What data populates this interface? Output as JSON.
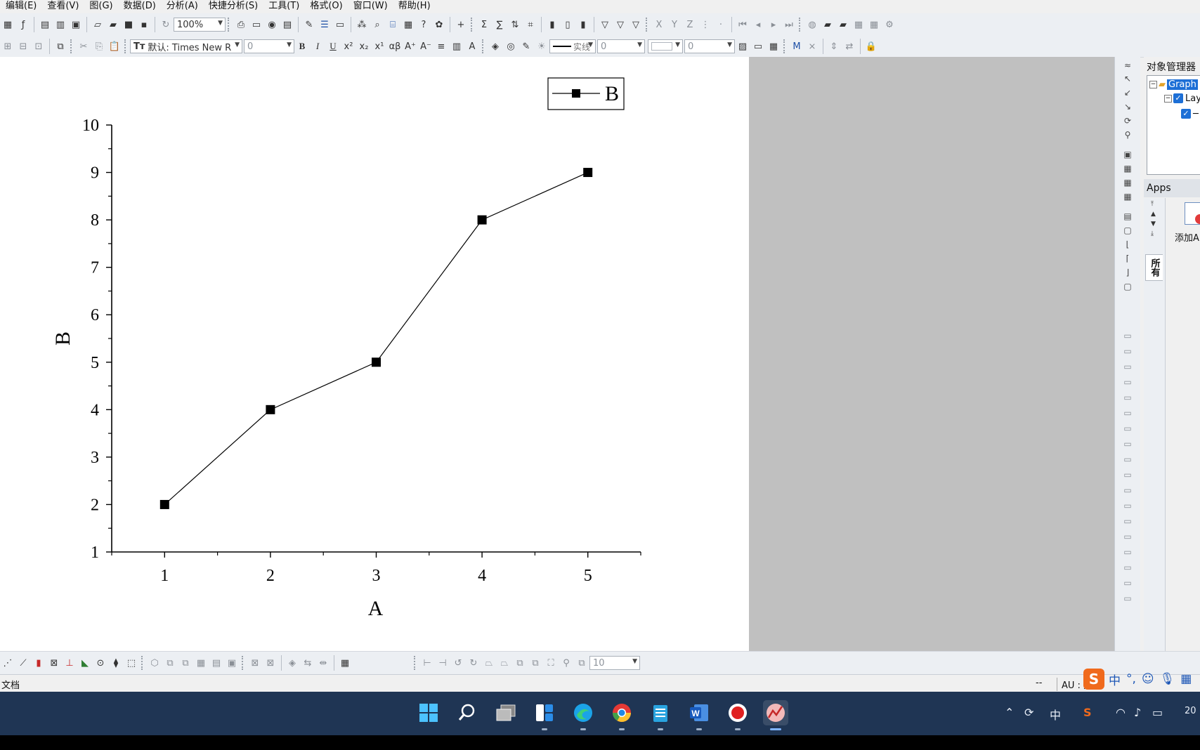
{
  "menu": [
    "编辑(E)",
    "查看(V)",
    "图(G)",
    "数据(D)",
    "分析(A)",
    "快捷分析(S)",
    "工具(T)",
    "格式(O)",
    "窗口(W)",
    "帮助(H)"
  ],
  "toolbar": {
    "zoom": "100%",
    "font": "默认: Times New R",
    "font_size": "0",
    "line_width": "0",
    "line_style_label": "实线",
    "box_value_1": "0",
    "box_value_2": "0",
    "bottom_size": "10"
  },
  "object_manager": {
    "title": "对象管理器",
    "graph_node": "Graph",
    "layer_node": "Lay"
  },
  "apps": {
    "title": "Apps",
    "all_tab": "所有",
    "add_app_label": "添加A"
  },
  "status": {
    "doc_label": "文档",
    "dash": "--",
    "au": "AU : 开"
  },
  "ime": {
    "s_logo": "S",
    "lang": "中",
    "punct": "°,"
  },
  "tray": {
    "lang": "中",
    "clock": "20"
  },
  "colors": {
    "page": "#ffffff",
    "gutter": "#c0c0c0",
    "taskbar": "#1f3554",
    "accent": "#1d6fd6"
  },
  "chart_data": {
    "type": "line",
    "x": [
      1,
      2,
      3,
      4,
      5
    ],
    "series": [
      {
        "name": "B",
        "values": [
          2,
          4,
          5,
          8,
          9
        ],
        "marker": "square"
      }
    ],
    "xlabel": "A",
    "ylabel": "B",
    "xlim": [
      0.5,
      5.5
    ],
    "ylim": [
      1,
      10
    ],
    "xticks": [
      "1",
      "2",
      "3",
      "4",
      "5"
    ],
    "yticks": [
      "1",
      "2",
      "3",
      "4",
      "5",
      "6",
      "7",
      "8",
      "9",
      "10"
    ],
    "legend": "top-right",
    "grid": false
  }
}
